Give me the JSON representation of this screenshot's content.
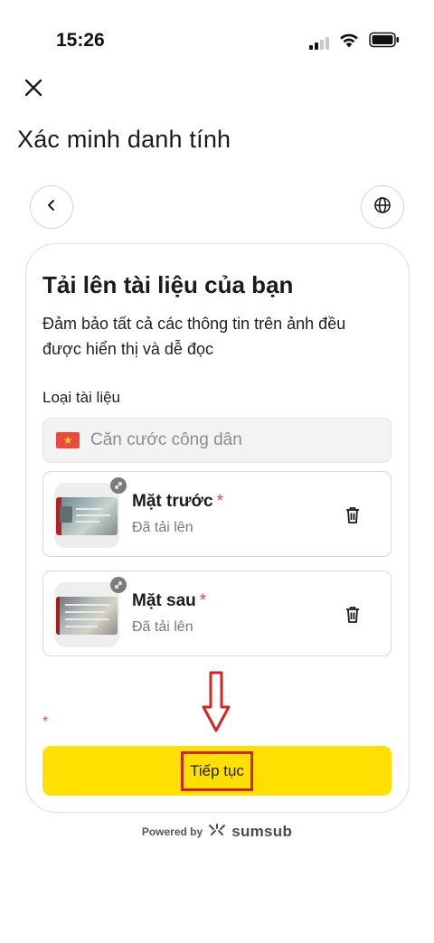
{
  "status_bar": {
    "time": "15:26",
    "signal_icon": "signal-icon",
    "wifi_icon": "wifi-icon",
    "battery_icon": "battery-icon"
  },
  "header": {
    "close_icon": "close-icon",
    "title": "Xác minh danh tính",
    "back_icon": "chevron-left-icon",
    "language_icon": "globe-icon"
  },
  "card": {
    "title": "Tải lên tài liệu của bạn",
    "description": "Đảm bảo tất cả các thông tin trên ảnh đều được hiển thị và dễ đọc",
    "document_type_label": "Loại tài liệu",
    "document_type_value": "Căn cước công dân",
    "uploads": [
      {
        "title": "Mặt trước",
        "required_mark": "*",
        "status": "Đã tải lên"
      },
      {
        "title": "Mặt sau",
        "required_mark": "*",
        "status": "Đã tải lên"
      }
    ],
    "required_note": "*",
    "continue_label": "Tiếp tục"
  },
  "footer": {
    "powered_by": "Powered by",
    "brand": "sumsub"
  },
  "colors": {
    "accent_button": "#ffe000",
    "required": "#d94b4b",
    "annotation": "#d42424"
  }
}
